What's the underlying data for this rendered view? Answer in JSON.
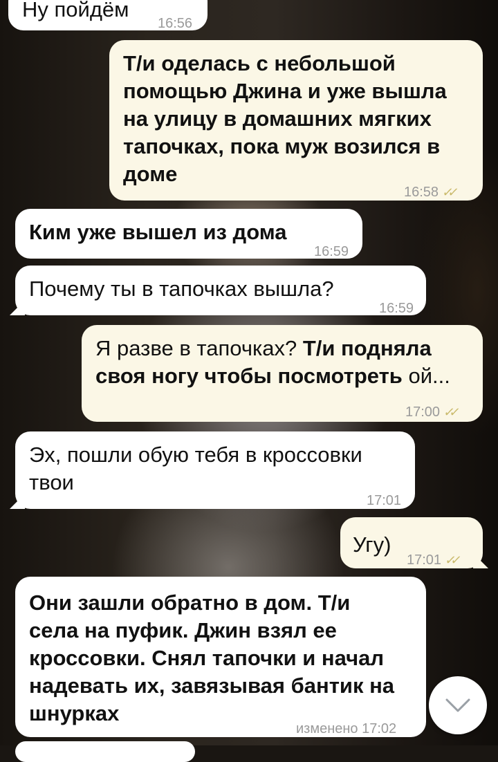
{
  "messages": [
    {
      "id": "m0",
      "dir": "in",
      "parts": [
        {
          "t": "Ну пойдём",
          "b": false
        }
      ],
      "time": "16:56"
    },
    {
      "id": "m1",
      "dir": "out",
      "parts": [
        {
          "t": "Т/и оделась с небольшой помощью Джина и уже вышла на улицу в домашних мягких тапочках, пока муж возился в доме",
          "b": true
        }
      ],
      "time": "16:58",
      "read": true
    },
    {
      "id": "m2",
      "dir": "in",
      "parts": [
        {
          "t": "Ким уже вышел из дома",
          "b": true
        }
      ],
      "time": "16:59"
    },
    {
      "id": "m3",
      "dir": "in",
      "parts": [
        {
          "t": "Почему ты в тапочках вышла?",
          "b": false
        }
      ],
      "time": "16:59"
    },
    {
      "id": "m4",
      "dir": "out",
      "parts": [
        {
          "t": "Я разве в тапочках? ",
          "b": false
        },
        {
          "t": "Т/и подняла своя ногу чтобы посмотреть",
          "b": true
        },
        {
          "t": " ой...",
          "b": false
        }
      ],
      "time": "17:00",
      "read": true
    },
    {
      "id": "m5",
      "dir": "in",
      "parts": [
        {
          "t": "Эх, пошли обую тебя в кроссовки твои",
          "b": false
        }
      ],
      "time": "17:01"
    },
    {
      "id": "m6",
      "dir": "out",
      "parts": [
        {
          "t": "Угу)",
          "b": false
        }
      ],
      "time": "17:01",
      "read": true
    },
    {
      "id": "m7",
      "dir": "in",
      "parts": [
        {
          "t": "Они зашли обратно в дом. Т/и села на пуфик. Джин взял ее кроссовки. Снял тапочки и начал надевать их, завязывая бантик на шнурках",
          "b": true
        }
      ],
      "time": "изменено 17:02"
    }
  ],
  "scroll_down_button": {
    "icon": "chevron-down-icon"
  },
  "colors": {
    "incoming": "#ffffff",
    "outgoing": "#fbf7e6",
    "read_check": "#c9b96a",
    "time": "#9a9a9a"
  }
}
